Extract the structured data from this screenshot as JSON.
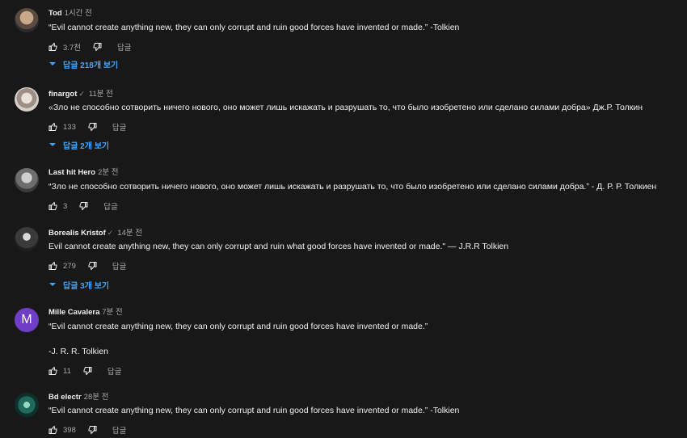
{
  "comments": [
    {
      "author": "Tod",
      "time": "1시간 전",
      "verified": false,
      "text_lines": [
        "“Evil cannot create anything new, they can only corrupt and ruin good forces have invented or made.” -Tolkien"
      ],
      "likes": "3.7천",
      "reply_label": "답글",
      "replies_label": "답글 218개 보기"
    },
    {
      "author": "finargot",
      "time": "11분 전",
      "verified": true,
      "text_lines": [
        "«Зло не способно сотворить ничего нового, оно может лишь искажать и разрушать то, что было изобретено или сделано силами добра» Дж.Р. Толкин"
      ],
      "likes": "133",
      "reply_label": "답글",
      "replies_label": "답글 2개 보기"
    },
    {
      "author": "Last hit Hero",
      "time": "2분 전",
      "verified": false,
      "text_lines": [
        "“Зло не способно сотворить ничего нового, оно может лишь искажать и разрушать то, что было изобретено или сделано силами добра.” - Д. Р. Р. Толкиен"
      ],
      "likes": "3",
      "reply_label": "답글",
      "replies_label": ""
    },
    {
      "author": "Borealis Kristof",
      "time": "14분 전",
      "verified": true,
      "text_lines": [
        "Evil cannot create anything new, they can only corrupt and ruin what good forces have invented or made.\" — J.R.R Tolkien"
      ],
      "likes": "279",
      "reply_label": "답글",
      "replies_label": "답글 3개 보기"
    },
    {
      "author": "Mille Cavalera",
      "time": "7분 전",
      "verified": false,
      "avatar_letter": "M",
      "text_lines": [
        "“Evil cannot create anything new, they can only corrupt and ruin good forces have invented or made.”",
        "",
        "-J. R. R. Tolkien"
      ],
      "likes": "11",
      "reply_label": "답글",
      "replies_label": ""
    },
    {
      "author": "Bd electr",
      "time": "28분 전",
      "verified": false,
      "text_lines": [
        "“Evil cannot create anything new, they can only corrupt and ruin good forces have invented or made.” -Tolkien"
      ],
      "likes": "398",
      "reply_label": "답글",
      "replies_label": ""
    }
  ],
  "icons": {
    "like": "thumb-up-icon",
    "dislike": "thumb-down-icon",
    "replies": "chevron-down-icon",
    "verified": "check-icon"
  },
  "colors": {
    "background": "#181818",
    "text": "#f1f1f1",
    "secondary": "#aaaaaa",
    "link": "#3ea6ff",
    "mille_avatar": "#6f3ec7"
  }
}
